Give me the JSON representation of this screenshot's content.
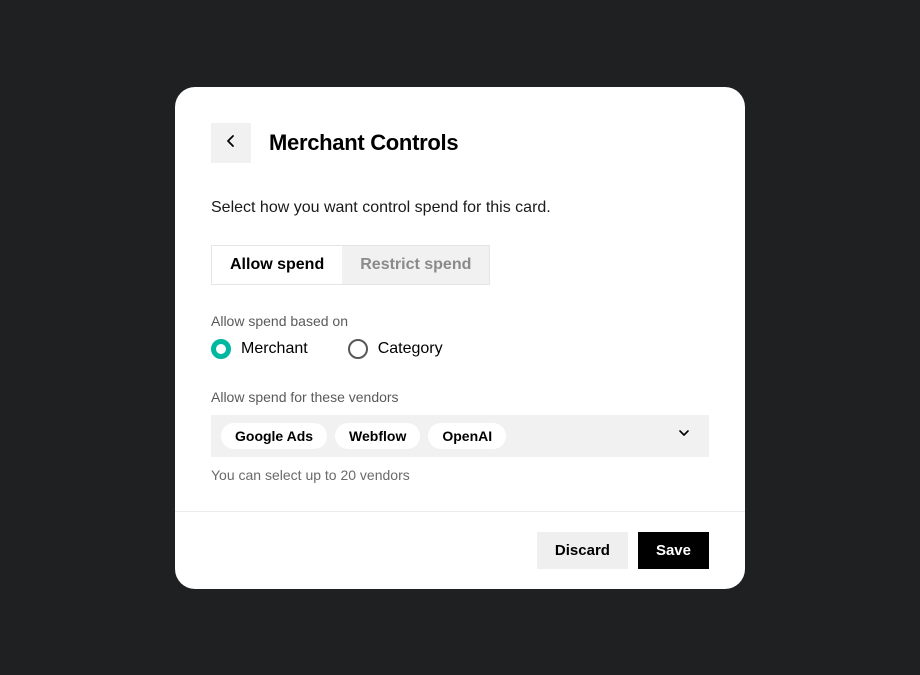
{
  "header": {
    "title": "Merchant Controls"
  },
  "subtitle": "Select how you want control spend for this card.",
  "tabs": {
    "allow": "Allow spend",
    "restrict": "Restrict spend"
  },
  "basis": {
    "label": "Allow spend based on",
    "merchant": "Merchant",
    "category": "Category"
  },
  "vendors": {
    "label": "Allow spend for these vendors",
    "chips": [
      "Google Ads",
      "Webflow",
      "OpenAI"
    ],
    "hint": "You can select up to 20 vendors"
  },
  "footer": {
    "discard": "Discard",
    "save": "Save"
  }
}
